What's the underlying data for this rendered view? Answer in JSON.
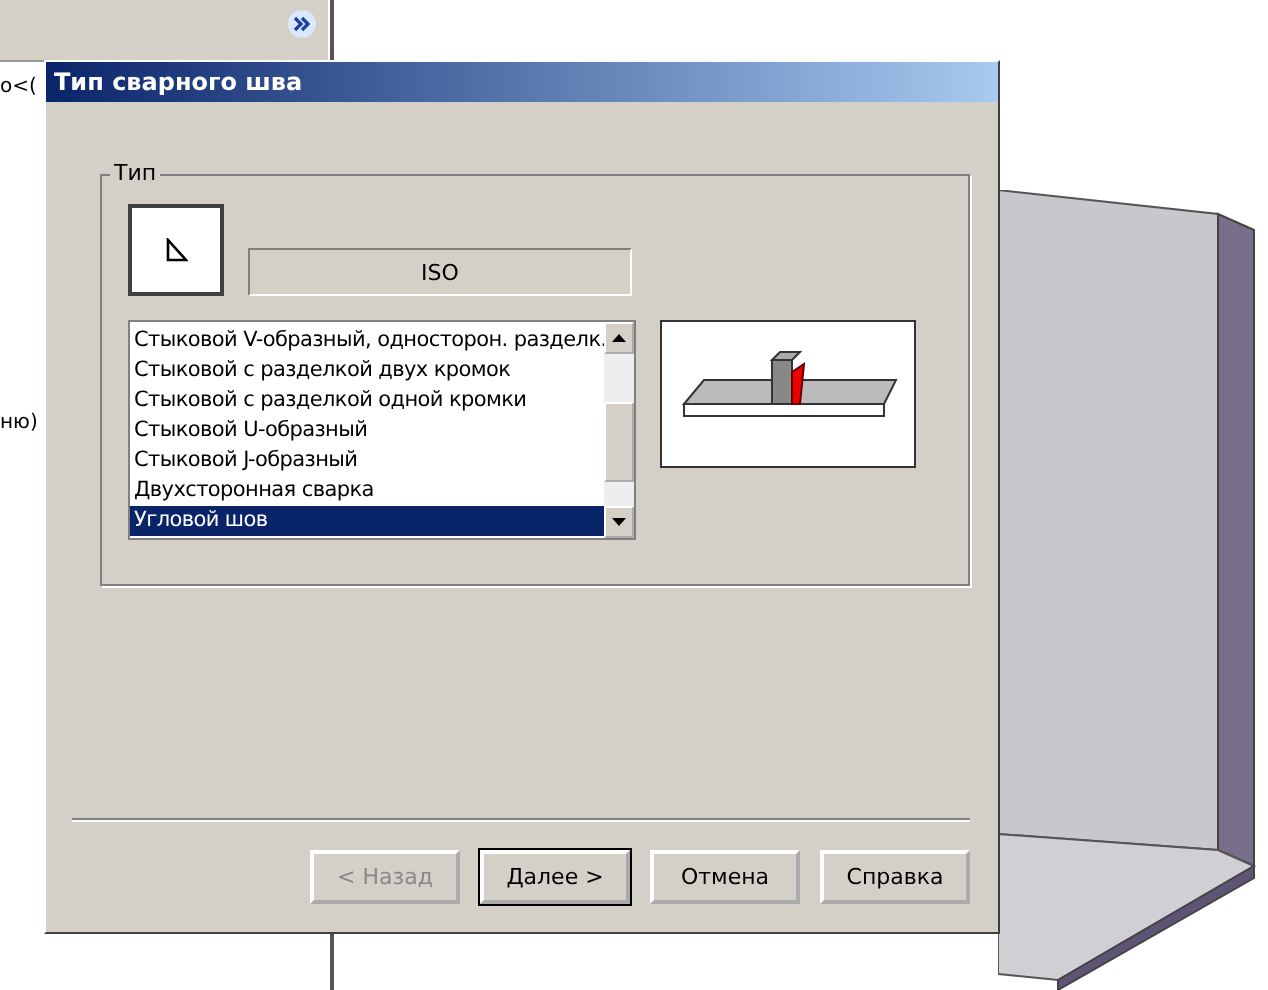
{
  "background_panel": {
    "fragments": [
      "о<(",
      "ню)"
    ]
  },
  "window": {
    "title": "Тип сварного шва"
  },
  "group": {
    "label": "Тип",
    "standard": "ISO",
    "items": [
      {
        "label": "Стыковой V-образный, односторон. разделк.",
        "selected": false
      },
      {
        "label": "Стыковой с разделкой двух кромок",
        "selected": false
      },
      {
        "label": "Стыковой с разделкой одной кромки",
        "selected": false
      },
      {
        "label": "Стыковой U-образный",
        "selected": false
      },
      {
        "label": "Стыковой J-образный",
        "selected": false
      },
      {
        "label": "Двухсторонная сварка",
        "selected": false
      },
      {
        "label": "Угловой шов",
        "selected": true
      }
    ]
  },
  "buttons": [
    {
      "label": "< Назад",
      "disabled": true,
      "default": false
    },
    {
      "label": "Далее >",
      "disabled": false,
      "default": true
    },
    {
      "label": "Отмена",
      "disabled": false,
      "default": false
    },
    {
      "label": "Справка",
      "disabled": false,
      "default": false
    }
  ]
}
